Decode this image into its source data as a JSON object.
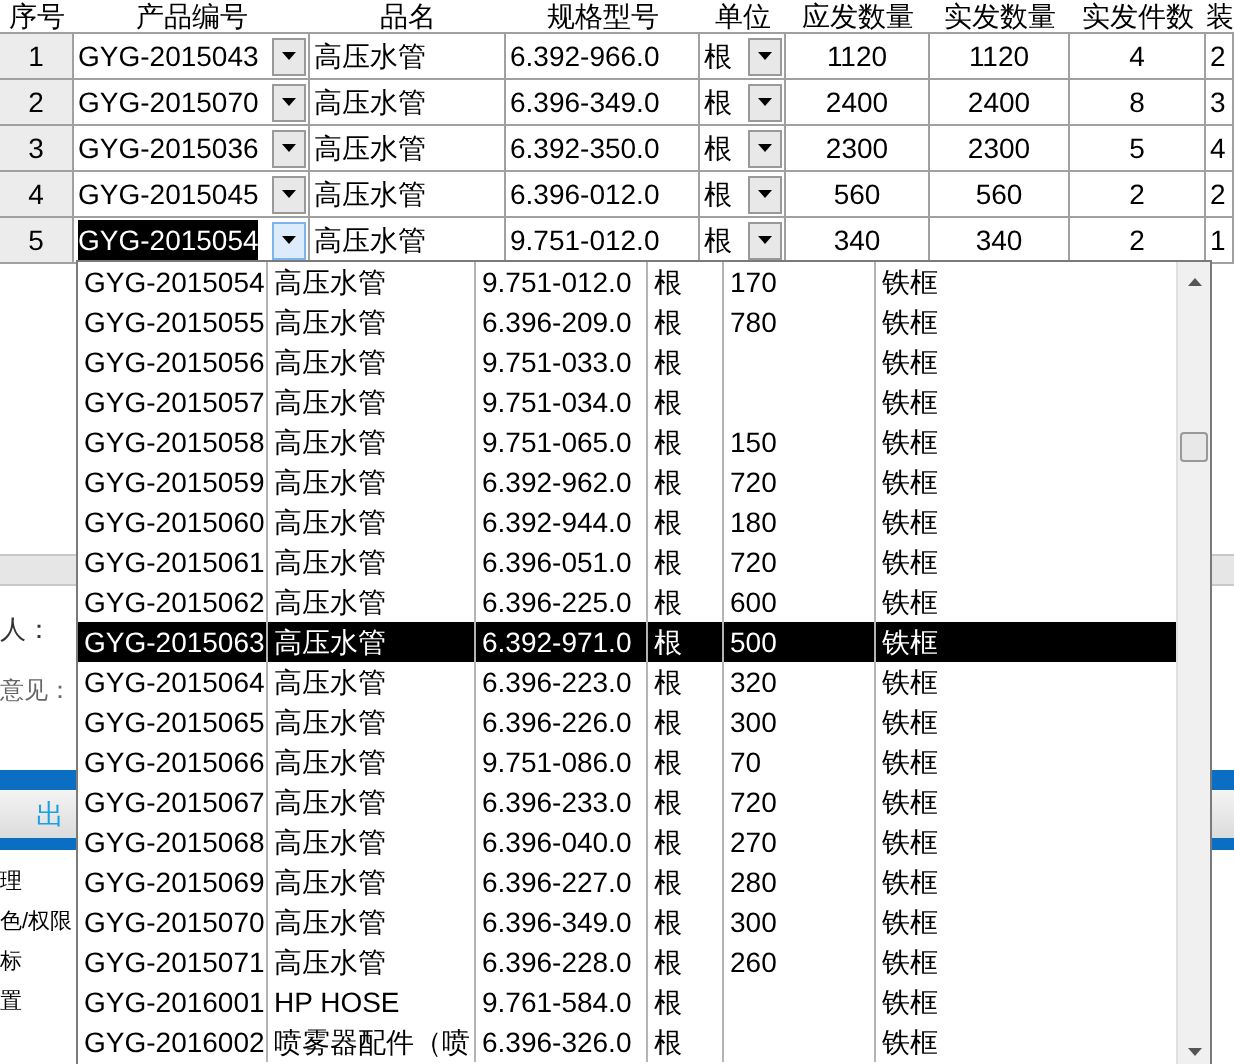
{
  "table": {
    "columns": [
      "序号",
      "产品编号",
      "品名",
      "规格型号",
      "单位",
      "应发数量",
      "实发数量",
      "实发件数",
      "装"
    ],
    "rows": [
      {
        "index": "1",
        "code": "GYG-2015043",
        "name": "高压水管",
        "spec": "6.392-966.0",
        "unit": "根",
        "due_qty": "1120",
        "sent_qty": "1120",
        "pieces": "4",
        "column_9": "2",
        "selected": false
      },
      {
        "index": "2",
        "code": "GYG-2015070",
        "name": "高压水管",
        "spec": "6.396-349.0",
        "unit": "根",
        "due_qty": "2400",
        "sent_qty": "2400",
        "pieces": "8",
        "column_9": "3",
        "selected": false
      },
      {
        "index": "3",
        "code": "GYG-2015036",
        "name": "高压水管",
        "spec": "6.392-350.0",
        "unit": "根",
        "due_qty": "2300",
        "sent_qty": "2300",
        "pieces": "5",
        "column_9": "4",
        "selected": false
      },
      {
        "index": "4",
        "code": "GYG-2015045",
        "name": "高压水管",
        "spec": "6.396-012.0",
        "unit": "根",
        "due_qty": "560",
        "sent_qty": "560",
        "pieces": "2",
        "column_9": "2",
        "selected": false
      },
      {
        "index": "5",
        "code": "GYG-2015054",
        "name": "高压水管",
        "spec": "9.751-012.0",
        "unit": "根",
        "due_qty": "340",
        "sent_qty": "340",
        "pieces": "2",
        "column_9": "1",
        "selected": true
      }
    ]
  },
  "form": {
    "labels": [
      "人：",
      "意见："
    ],
    "button": "出",
    "sidebar": [
      "理",
      "色/权限",
      "标",
      "置"
    ]
  },
  "dropdown": {
    "rows": [
      {
        "code": "GYG-2015054",
        "name": "高压水管",
        "spec": "9.751-012.0",
        "unit": "根",
        "qty": "170",
        "frame": "铁框",
        "selected": false
      },
      {
        "code": "GYG-2015055",
        "name": "高压水管",
        "spec": "6.396-209.0",
        "unit": "根",
        "qty": "780",
        "frame": "铁框",
        "selected": false
      },
      {
        "code": "GYG-2015056",
        "name": "高压水管",
        "spec": "9.751-033.0",
        "unit": "根",
        "frame": "铁框",
        "selected": false
      },
      {
        "code": "GYG-2015057",
        "name": "高压水管",
        "spec": "9.751-034.0",
        "unit": "根",
        "frame": "铁框",
        "selected": false
      },
      {
        "code": "GYG-2015058",
        "name": "高压水管",
        "spec": "9.751-065.0",
        "unit": "根",
        "qty": "150",
        "frame": "铁框",
        "selected": false
      },
      {
        "code": "GYG-2015059",
        "name": "高压水管",
        "spec": "6.392-962.0",
        "unit": "根",
        "qty": "720",
        "frame": "铁框",
        "selected": false
      },
      {
        "code": "GYG-2015060",
        "name": "高压水管",
        "spec": "6.392-944.0",
        "unit": "根",
        "qty": "180",
        "frame": "铁框",
        "selected": false
      },
      {
        "code": "GYG-2015061",
        "name": "高压水管",
        "spec": "6.396-051.0",
        "unit": "根",
        "qty": "720",
        "frame": "铁框",
        "selected": false
      },
      {
        "code": "GYG-2015062",
        "name": "高压水管",
        "spec": "6.396-225.0",
        "unit": "根",
        "qty": "600",
        "frame": "铁框",
        "selected": false
      },
      {
        "code": "GYG-2015063",
        "name": "高压水管",
        "spec": "6.392-971.0",
        "unit": "根",
        "qty": "500",
        "frame": "铁框",
        "selected": true
      },
      {
        "code": "GYG-2015064",
        "name": "高压水管",
        "spec": "6.396-223.0",
        "unit": "根",
        "qty": "320",
        "frame": "铁框",
        "selected": false
      },
      {
        "code": "GYG-2015065",
        "name": "高压水管",
        "spec": "6.396-226.0",
        "unit": "根",
        "qty": "300",
        "frame": "铁框",
        "selected": false
      },
      {
        "code": "GYG-2015066",
        "name": "高压水管",
        "spec": "9.751-086.0",
        "unit": "根",
        "qty": "70",
        "frame": "铁框",
        "selected": false
      },
      {
        "code": "GYG-2015067",
        "name": "高压水管",
        "spec": "6.396-233.0",
        "unit": "根",
        "qty": "720",
        "frame": "铁框",
        "selected": false
      },
      {
        "code": "GYG-2015068",
        "name": "高压水管",
        "spec": "6.396-040.0",
        "unit": "根",
        "qty": "270",
        "frame": "铁框",
        "selected": false
      },
      {
        "code": "GYG-2015069",
        "name": "高压水管",
        "spec": "6.396-227.0",
        "unit": "根",
        "qty": "280",
        "frame": "铁框",
        "selected": false
      },
      {
        "code": "GYG-2015070",
        "name": "高压水管",
        "spec": "6.396-349.0",
        "unit": "根",
        "qty": "300",
        "frame": "铁框",
        "selected": false
      },
      {
        "code": "GYG-2015071",
        "name": "高压水管",
        "spec": "6.396-228.0",
        "unit": "根",
        "qty": "260",
        "frame": "铁框",
        "selected": false
      },
      {
        "code": "GYG-2016001",
        "name": "HP HOSE",
        "spec": "9.761-584.0",
        "unit": "根",
        "frame": "铁框",
        "selected": false
      },
      {
        "code": "GYG-2016002",
        "name": "喷雾器配件（喷",
        "spec": "6.396-326.0",
        "unit": "根",
        "frame": "铁框",
        "selected": false
      }
    ]
  }
}
